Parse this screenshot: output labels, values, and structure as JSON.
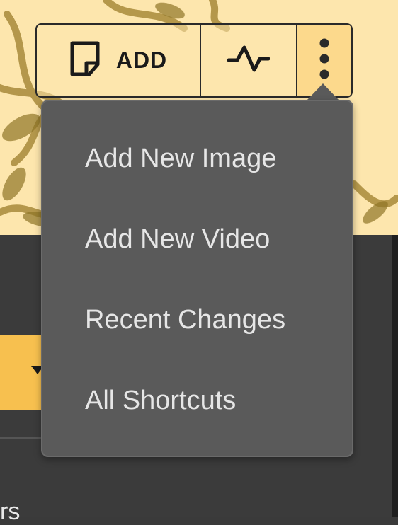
{
  "toolbar": {
    "add_label": "ADD",
    "add_icon": "sticky-note-icon",
    "activity_icon": "activity-pulse-icon",
    "more_icon": "more-vertical-icon"
  },
  "menu": {
    "items": [
      {
        "label": "Add New Image"
      },
      {
        "label": "Add New Video"
      },
      {
        "label": "Recent Changes"
      },
      {
        "label": "All Shortcuts"
      }
    ]
  },
  "background": {
    "partial_text": "rs"
  },
  "colors": {
    "banner": "#fde6ad",
    "accent": "#f7c04f",
    "menu_bg": "#5a5a5a",
    "menu_text": "#e6e6e6",
    "page_bg": "#3b3b3b"
  }
}
